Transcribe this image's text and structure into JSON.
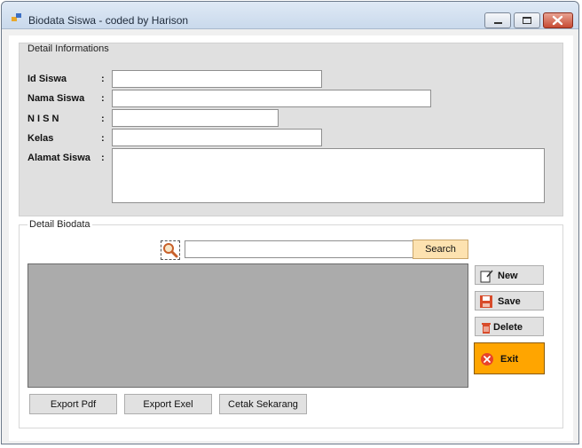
{
  "window": {
    "title": "Biodata Siswa - coded by Harison"
  },
  "detail_info": {
    "title": "Detail Informations",
    "fields": [
      {
        "label": "Id Siswa",
        "colon": ":",
        "value": ""
      },
      {
        "label": "Nama Siswa",
        "colon": ":",
        "value": ""
      },
      {
        "label": "N I S N",
        "colon": ":",
        "value": ""
      },
      {
        "label": "Kelas",
        "colon": ":",
        "value": ""
      },
      {
        "label": "Alamat Siswa",
        "colon": ":",
        "value": ""
      }
    ]
  },
  "detail_biodata": {
    "title": "Detail Biodata",
    "search": {
      "value": "",
      "button_label": "Search"
    },
    "actions": {
      "new_label": "New",
      "save_label": "Save",
      "delete_label": "Delete",
      "exit_label": "Exit"
    },
    "exports": {
      "pdf_label": "Export Pdf",
      "excel_label": "Export Exel",
      "print_label": "Cetak Sekarang"
    }
  },
  "colors": {
    "search_button": "#fde2b0",
    "exit_button": "#ffa500",
    "grid_background": "#ababab"
  }
}
